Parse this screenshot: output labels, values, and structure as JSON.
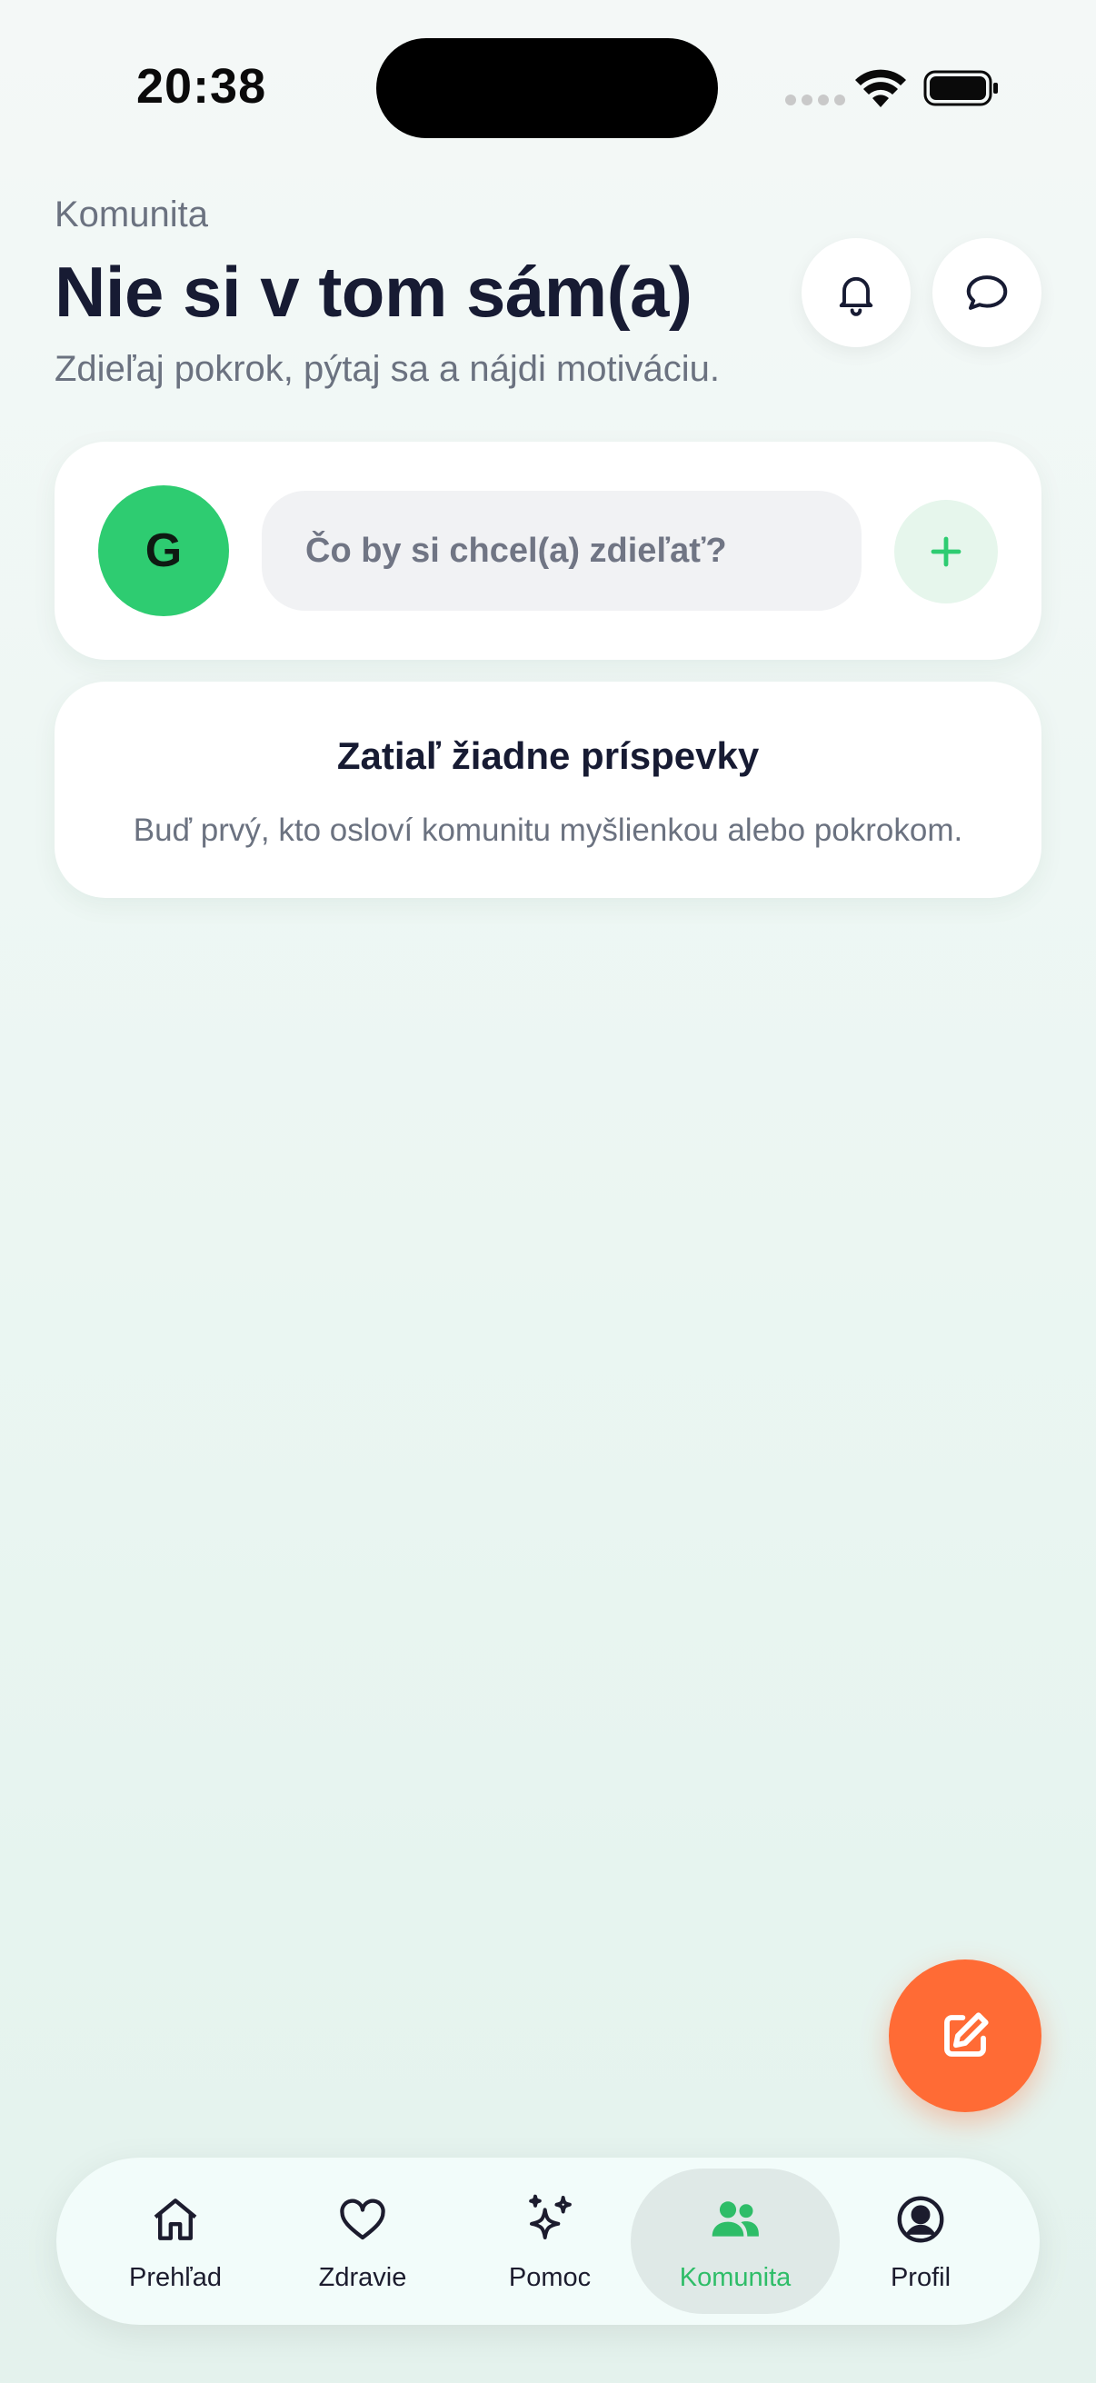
{
  "status_bar": {
    "time": "20:38"
  },
  "header": {
    "kicker": "Komunita",
    "title": "Nie si v tom sám(a)",
    "subtitle": "Zdieľaj pokrok, pýtaj sa a nájdi motiváciu."
  },
  "composer": {
    "avatar_initial": "G",
    "placeholder": "Čo by si chcel(a) zdieľať?"
  },
  "empty_state": {
    "title": "Zatiaľ žiadne príspevky",
    "text": "Buď prvý, kto osloví komunitu myšlienkou alebo pokrokom."
  },
  "tabs": [
    {
      "label": "Prehľad",
      "icon": "home-icon"
    },
    {
      "label": "Zdravie",
      "icon": "heart-icon"
    },
    {
      "label": "Pomoc",
      "icon": "sparkles-icon"
    },
    {
      "label": "Komunita",
      "icon": "people-icon",
      "active": true
    },
    {
      "label": "Profil",
      "icon": "user-circle-icon"
    }
  ],
  "colors": {
    "accent": "#2ecc71",
    "fab": "#ff6b35",
    "title": "#171b33",
    "muted": "#6b7280"
  }
}
